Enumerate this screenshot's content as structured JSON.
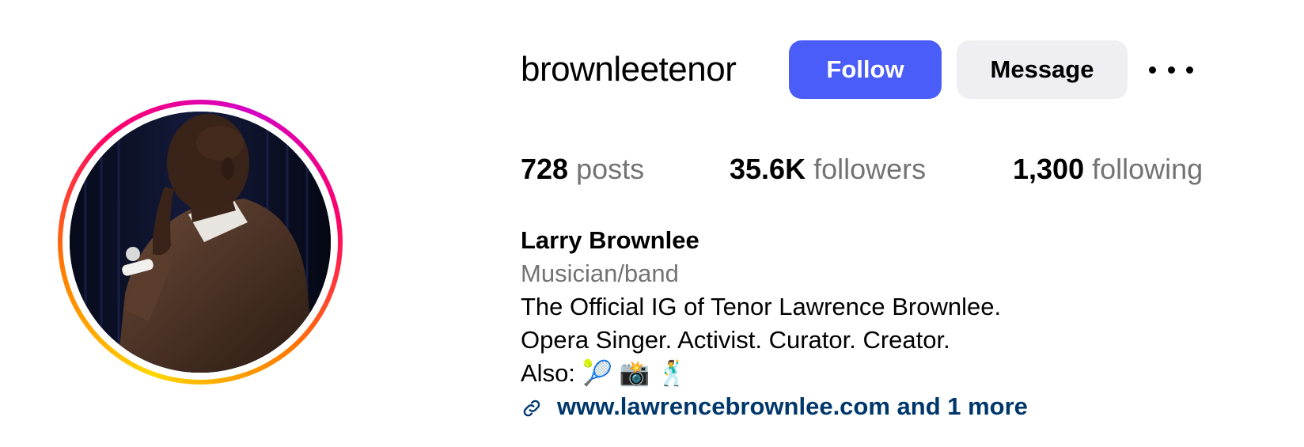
{
  "profile": {
    "username": "brownleetenor",
    "follow_label": "Follow",
    "message_label": "Message"
  },
  "stats": {
    "posts_count": "728",
    "posts_label": "posts",
    "followers_count": "35.6K",
    "followers_label": "followers",
    "following_count": "1,300",
    "following_label": "following"
  },
  "bio": {
    "name": "Larry Brownlee",
    "category": "Musician/band",
    "line1": "The Official IG of Tenor Lawrence Brownlee.",
    "line2": "Opera Singer. Activist. Curator. Creator.",
    "line3": "Also: 🎾 📸 🕺",
    "link_text": "www.lawrencebrownlee.com and 1 more"
  },
  "colors": {
    "follow_button": "#4a5df9",
    "message_button": "#efeff3",
    "link": "#00376b",
    "secondary_text": "#737373"
  },
  "icons": {
    "more": "more-options-icon",
    "link": "link-icon"
  }
}
